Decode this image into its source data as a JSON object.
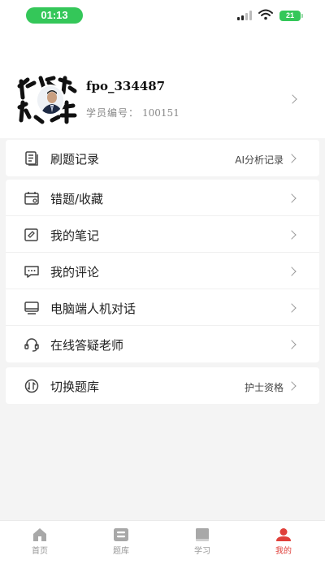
{
  "status_bar": {
    "time": "01:13",
    "battery": "21"
  },
  "profile": {
    "username": "fpo_334487",
    "id_label": "学员编号：",
    "id_value": "100151"
  },
  "records": {
    "label": "刷题记录",
    "extra": "AI分析记录"
  },
  "menu": [
    {
      "label": "错题/收藏",
      "icon": "calendar-icon"
    },
    {
      "label": "我的笔记",
      "icon": "note-icon"
    },
    {
      "label": "我的评论",
      "icon": "comment-icon"
    },
    {
      "label": "电脑端人机对话",
      "icon": "computer-icon"
    },
    {
      "label": "在线答疑老师",
      "icon": "headset-icon"
    }
  ],
  "bank": {
    "label": "切换题库",
    "extra": "护士资格"
  },
  "tabs": [
    {
      "label": "首页",
      "icon": "home-icon"
    },
    {
      "label": "题库",
      "icon": "question-bank-icon"
    },
    {
      "label": "学习",
      "icon": "book-icon"
    },
    {
      "label": "我的",
      "icon": "profile-icon",
      "active": true
    }
  ],
  "colors": {
    "accent": "#e0403b",
    "status_green": "#34c759",
    "background": "#f4f4f4"
  }
}
